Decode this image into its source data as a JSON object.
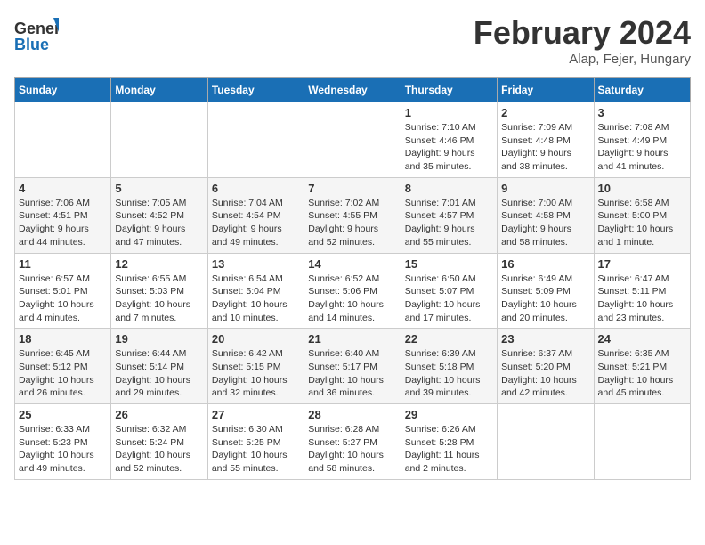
{
  "header": {
    "logo_line1": "General",
    "logo_line2": "Blue",
    "month": "February 2024",
    "location": "Alap, Fejer, Hungary"
  },
  "weekdays": [
    "Sunday",
    "Monday",
    "Tuesday",
    "Wednesday",
    "Thursday",
    "Friday",
    "Saturday"
  ],
  "weeks": [
    [
      {
        "day": "",
        "info": ""
      },
      {
        "day": "",
        "info": ""
      },
      {
        "day": "",
        "info": ""
      },
      {
        "day": "",
        "info": ""
      },
      {
        "day": "1",
        "info": "Sunrise: 7:10 AM\nSunset: 4:46 PM\nDaylight: 9 hours\nand 35 minutes."
      },
      {
        "day": "2",
        "info": "Sunrise: 7:09 AM\nSunset: 4:48 PM\nDaylight: 9 hours\nand 38 minutes."
      },
      {
        "day": "3",
        "info": "Sunrise: 7:08 AM\nSunset: 4:49 PM\nDaylight: 9 hours\nand 41 minutes."
      }
    ],
    [
      {
        "day": "4",
        "info": "Sunrise: 7:06 AM\nSunset: 4:51 PM\nDaylight: 9 hours\nand 44 minutes."
      },
      {
        "day": "5",
        "info": "Sunrise: 7:05 AM\nSunset: 4:52 PM\nDaylight: 9 hours\nand 47 minutes."
      },
      {
        "day": "6",
        "info": "Sunrise: 7:04 AM\nSunset: 4:54 PM\nDaylight: 9 hours\nand 49 minutes."
      },
      {
        "day": "7",
        "info": "Sunrise: 7:02 AM\nSunset: 4:55 PM\nDaylight: 9 hours\nand 52 minutes."
      },
      {
        "day": "8",
        "info": "Sunrise: 7:01 AM\nSunset: 4:57 PM\nDaylight: 9 hours\nand 55 minutes."
      },
      {
        "day": "9",
        "info": "Sunrise: 7:00 AM\nSunset: 4:58 PM\nDaylight: 9 hours\nand 58 minutes."
      },
      {
        "day": "10",
        "info": "Sunrise: 6:58 AM\nSunset: 5:00 PM\nDaylight: 10 hours\nand 1 minute."
      }
    ],
    [
      {
        "day": "11",
        "info": "Sunrise: 6:57 AM\nSunset: 5:01 PM\nDaylight: 10 hours\nand 4 minutes."
      },
      {
        "day": "12",
        "info": "Sunrise: 6:55 AM\nSunset: 5:03 PM\nDaylight: 10 hours\nand 7 minutes."
      },
      {
        "day": "13",
        "info": "Sunrise: 6:54 AM\nSunset: 5:04 PM\nDaylight: 10 hours\nand 10 minutes."
      },
      {
        "day": "14",
        "info": "Sunrise: 6:52 AM\nSunset: 5:06 PM\nDaylight: 10 hours\nand 14 minutes."
      },
      {
        "day": "15",
        "info": "Sunrise: 6:50 AM\nSunset: 5:07 PM\nDaylight: 10 hours\nand 17 minutes."
      },
      {
        "day": "16",
        "info": "Sunrise: 6:49 AM\nSunset: 5:09 PM\nDaylight: 10 hours\nand 20 minutes."
      },
      {
        "day": "17",
        "info": "Sunrise: 6:47 AM\nSunset: 5:11 PM\nDaylight: 10 hours\nand 23 minutes."
      }
    ],
    [
      {
        "day": "18",
        "info": "Sunrise: 6:45 AM\nSunset: 5:12 PM\nDaylight: 10 hours\nand 26 minutes."
      },
      {
        "day": "19",
        "info": "Sunrise: 6:44 AM\nSunset: 5:14 PM\nDaylight: 10 hours\nand 29 minutes."
      },
      {
        "day": "20",
        "info": "Sunrise: 6:42 AM\nSunset: 5:15 PM\nDaylight: 10 hours\nand 32 minutes."
      },
      {
        "day": "21",
        "info": "Sunrise: 6:40 AM\nSunset: 5:17 PM\nDaylight: 10 hours\nand 36 minutes."
      },
      {
        "day": "22",
        "info": "Sunrise: 6:39 AM\nSunset: 5:18 PM\nDaylight: 10 hours\nand 39 minutes."
      },
      {
        "day": "23",
        "info": "Sunrise: 6:37 AM\nSunset: 5:20 PM\nDaylight: 10 hours\nand 42 minutes."
      },
      {
        "day": "24",
        "info": "Sunrise: 6:35 AM\nSunset: 5:21 PM\nDaylight: 10 hours\nand 45 minutes."
      }
    ],
    [
      {
        "day": "25",
        "info": "Sunrise: 6:33 AM\nSunset: 5:23 PM\nDaylight: 10 hours\nand 49 minutes."
      },
      {
        "day": "26",
        "info": "Sunrise: 6:32 AM\nSunset: 5:24 PM\nDaylight: 10 hours\nand 52 minutes."
      },
      {
        "day": "27",
        "info": "Sunrise: 6:30 AM\nSunset: 5:25 PM\nDaylight: 10 hours\nand 55 minutes."
      },
      {
        "day": "28",
        "info": "Sunrise: 6:28 AM\nSunset: 5:27 PM\nDaylight: 10 hours\nand 58 minutes."
      },
      {
        "day": "29",
        "info": "Sunrise: 6:26 AM\nSunset: 5:28 PM\nDaylight: 11 hours\nand 2 minutes."
      },
      {
        "day": "",
        "info": ""
      },
      {
        "day": "",
        "info": ""
      }
    ]
  ]
}
